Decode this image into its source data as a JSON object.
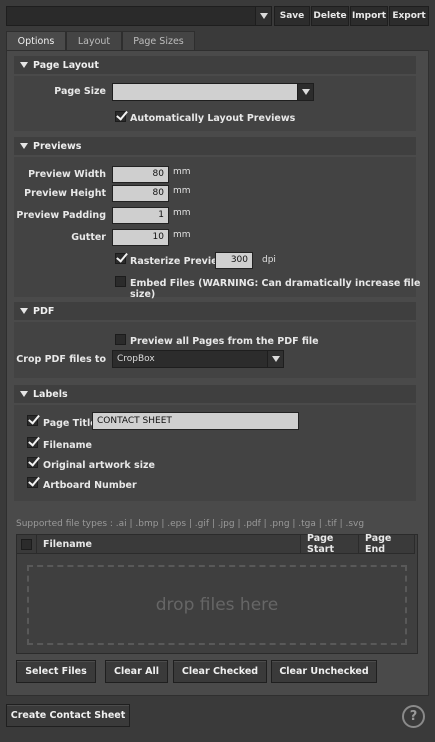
{
  "toolbar": {
    "preset_value": "",
    "buttons": [
      "Save",
      "Delete",
      "Import",
      "Export"
    ]
  },
  "tabs": [
    "Options",
    "Layout",
    "Page Sizes"
  ],
  "active_tab": "Options",
  "page_layout": {
    "header": "Page Layout",
    "page_size_label": "Page Size",
    "page_size_value": "",
    "auto_layout_label": "Automatically Layout Previews",
    "auto_layout_checked": true
  },
  "previews": {
    "header": "Previews",
    "width_label": "Preview Width",
    "width_value": "80",
    "width_unit": "mm",
    "height_label": "Preview Height",
    "height_value": "80",
    "height_unit": "mm",
    "padding_label": "Preview Padding",
    "padding_value": "1",
    "padding_unit": "mm",
    "gutter_label": "Gutter",
    "gutter_value": "10",
    "gutter_unit": "mm",
    "rasterize_label": "Rasterize Previews",
    "rasterize_checked": true,
    "dpi_value": "300",
    "dpi_unit": "dpi",
    "embed_label": "Embed Files (WARNING: Can dramatically increase file size)",
    "embed_checked": false
  },
  "pdf": {
    "header": "PDF",
    "preview_all_label": "Preview all Pages from the PDF file",
    "preview_all_checked": false,
    "crop_label": "Crop PDF files to",
    "crop_value": "CropBox"
  },
  "labels": {
    "header": "Labels",
    "page_title_label": "Page Title",
    "page_title_checked": true,
    "page_title_value": "CONTACT SHEET",
    "filename_label": "Filename",
    "filename_checked": true,
    "artwork_size_label": "Original artwork size",
    "artwork_size_checked": true,
    "artboard_number_label": "Artboard Number",
    "artboard_number_checked": true
  },
  "files": {
    "supported_text": "Supported file types : .ai | .bmp | .eps | .gif | .jpg | .pdf | .png | .tga | .tif | .svg",
    "columns": [
      "Filename",
      "Page Start",
      "Page End"
    ],
    "dropzone_text": "drop files here"
  },
  "actions": {
    "select_files": "Select Files",
    "clear_all": "Clear All",
    "clear_checked": "Clear Checked",
    "clear_unchecked": "Clear Unchecked",
    "create": "Create Contact Sheet",
    "help": "?"
  },
  "colors": {
    "background": "#3a3a3a",
    "panel": "#4a4a4a",
    "input_light": "#cfcfcf"
  }
}
